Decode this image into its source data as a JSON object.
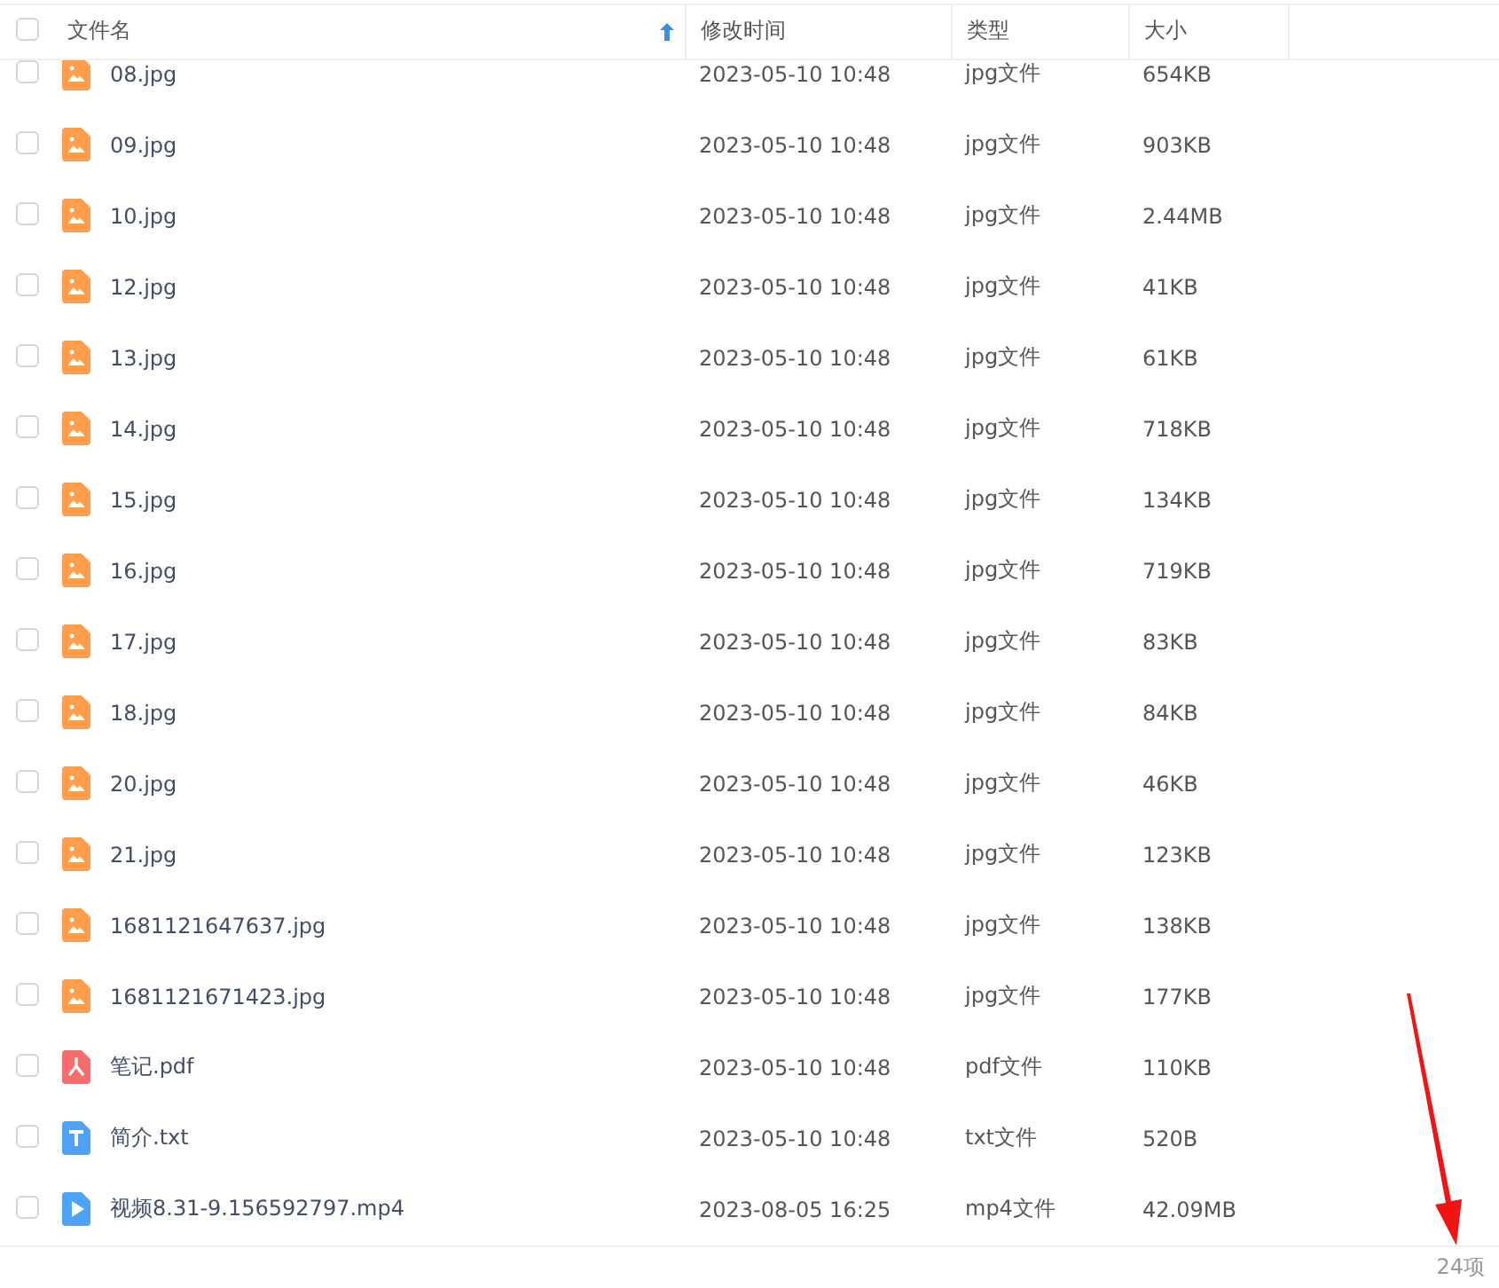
{
  "header": {
    "checked": false,
    "columns": [
      {
        "label": "文件名",
        "sorted": true
      },
      {
        "label": "修改时间",
        "sorted": false
      },
      {
        "label": "类型",
        "sorted": false
      },
      {
        "label": "大小",
        "sorted": false
      }
    ]
  },
  "files": [
    {
      "kind": "image",
      "checked": false,
      "name": "08.jpg",
      "modified": "2023-05-10 10:48",
      "type": "jpg文件",
      "size": "654KB"
    },
    {
      "kind": "image",
      "checked": false,
      "name": "09.jpg",
      "modified": "2023-05-10 10:48",
      "type": "jpg文件",
      "size": "903KB"
    },
    {
      "kind": "image",
      "checked": false,
      "name": "10.jpg",
      "modified": "2023-05-10 10:48",
      "type": "jpg文件",
      "size": "2.44MB"
    },
    {
      "kind": "image",
      "checked": false,
      "name": "12.jpg",
      "modified": "2023-05-10 10:48",
      "type": "jpg文件",
      "size": "41KB"
    },
    {
      "kind": "image",
      "checked": false,
      "name": "13.jpg",
      "modified": "2023-05-10 10:48",
      "type": "jpg文件",
      "size": "61KB"
    },
    {
      "kind": "image",
      "checked": false,
      "name": "14.jpg",
      "modified": "2023-05-10 10:48",
      "type": "jpg文件",
      "size": "718KB"
    },
    {
      "kind": "image",
      "checked": false,
      "name": "15.jpg",
      "modified": "2023-05-10 10:48",
      "type": "jpg文件",
      "size": "134KB"
    },
    {
      "kind": "image",
      "checked": false,
      "name": "16.jpg",
      "modified": "2023-05-10 10:48",
      "type": "jpg文件",
      "size": "719KB"
    },
    {
      "kind": "image",
      "checked": false,
      "name": "17.jpg",
      "modified": "2023-05-10 10:48",
      "type": "jpg文件",
      "size": "83KB"
    },
    {
      "kind": "image",
      "checked": false,
      "name": "18.jpg",
      "modified": "2023-05-10 10:48",
      "type": "jpg文件",
      "size": "84KB"
    },
    {
      "kind": "image",
      "checked": false,
      "name": "20.jpg",
      "modified": "2023-05-10 10:48",
      "type": "jpg文件",
      "size": "46KB"
    },
    {
      "kind": "image",
      "checked": false,
      "name": "21.jpg",
      "modified": "2023-05-10 10:48",
      "type": "jpg文件",
      "size": "123KB"
    },
    {
      "kind": "image",
      "checked": false,
      "name": "1681121647637.jpg",
      "modified": "2023-05-10 10:48",
      "type": "jpg文件",
      "size": "138KB"
    },
    {
      "kind": "image",
      "checked": false,
      "name": "1681121671423.jpg",
      "modified": "2023-05-10 10:48",
      "type": "jpg文件",
      "size": "177KB"
    },
    {
      "kind": "pdf",
      "checked": false,
      "name": "笔记.pdf",
      "modified": "2023-05-10 10:48",
      "type": "pdf文件",
      "size": "110KB"
    },
    {
      "kind": "text",
      "checked": false,
      "name": "简介.txt",
      "modified": "2023-05-10 10:48",
      "type": "txt文件",
      "size": "520B"
    },
    {
      "kind": "video",
      "checked": false,
      "name": "视频8.31-9.156592797.mp4",
      "modified": "2023-08-05 16:25",
      "type": "mp4文件",
      "size": "42.09MB"
    }
  ],
  "footer": {
    "count": "24项"
  }
}
